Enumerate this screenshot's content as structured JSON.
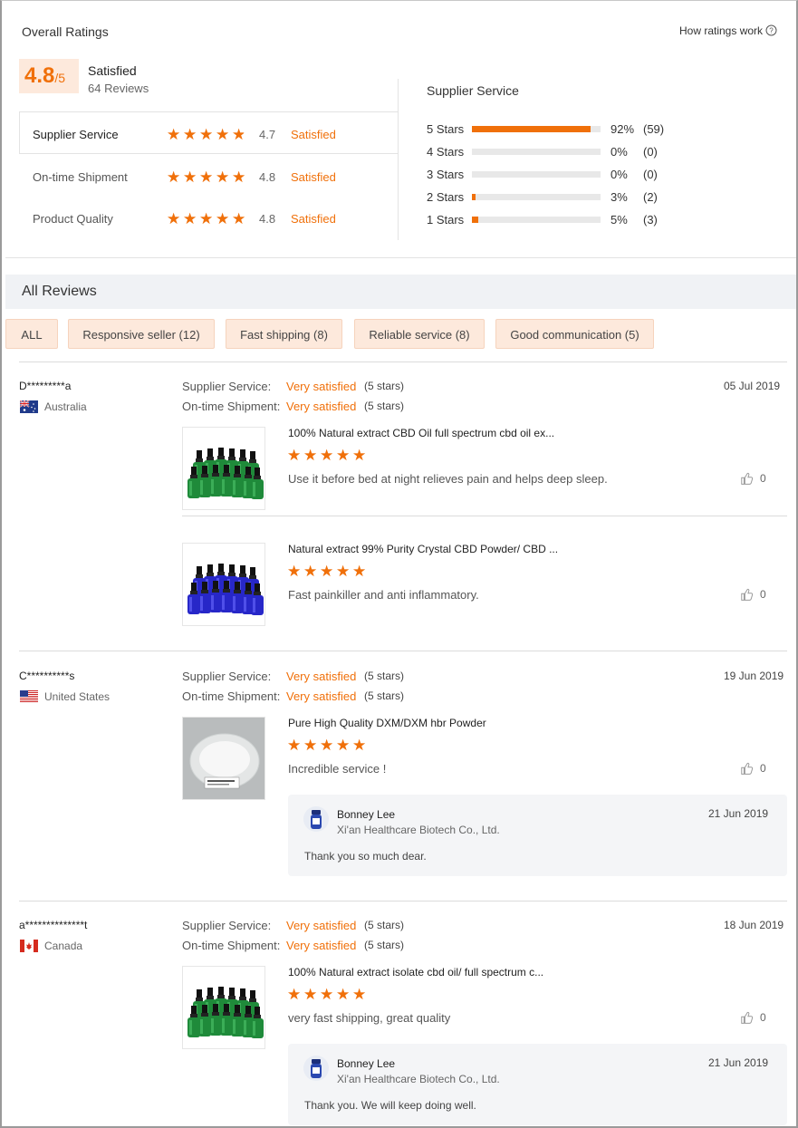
{
  "overall": {
    "title": "Overall Ratings",
    "how_link": "How ratings work",
    "score": "4.8",
    "score_suffix": "/5",
    "label": "Satisfied",
    "reviews_count": "64 Reviews",
    "metrics": [
      {
        "name": "Supplier Service",
        "rating": 4.7,
        "value": "4.7",
        "label": "Satisfied"
      },
      {
        "name": "On-time Shipment",
        "rating": 4.8,
        "value": "4.8",
        "label": "Satisfied"
      },
      {
        "name": "Product Quality",
        "rating": 4.8,
        "value": "4.8",
        "label": "Satisfied"
      }
    ]
  },
  "distribution": {
    "title": "Supplier Service",
    "rows": [
      {
        "label": "5 Stars",
        "fraction": 0.92,
        "percent": "92%",
        "count": "(59)"
      },
      {
        "label": "4 Stars",
        "fraction": 0,
        "percent": "0%",
        "count": "(0)"
      },
      {
        "label": "3 Stars",
        "fraction": 0,
        "percent": "0%",
        "count": "(0)"
      },
      {
        "label": "2 Stars",
        "fraction": 0.03,
        "percent": "3%",
        "count": "(2)"
      },
      {
        "label": "1 Stars",
        "fraction": 0.05,
        "percent": "5%",
        "count": "(3)"
      }
    ]
  },
  "reviews_header": "All Reviews",
  "filters": [
    "ALL",
    "Responsive seller (12)",
    "Fast shipping (8)",
    "Reliable service (8)",
    "Good communication (5)"
  ],
  "labels": {
    "supplier_service": "Supplier Service:",
    "ontime_shipment": "On-time Shipment:",
    "very_satisfied": "Very satisfied",
    "five_stars": "(5 stars)"
  },
  "reviews": [
    {
      "user": "D*********a",
      "country": "Australia",
      "flag": "australia",
      "date": "05 Jul 2019",
      "products": [
        {
          "title": "100% Natural extract CBD Oil full spectrum cbd oil ex...",
          "text": "Use it before bed at night relieves pain and helps deep sleep.",
          "likes": "0",
          "image": "green-bottles"
        },
        {
          "title": "Natural extract 99% Purity Crystal CBD Powder/ CBD ...",
          "text": "Fast painkiller and anti inflammatory.",
          "likes": "0",
          "image": "blue-bottles"
        }
      ]
    },
    {
      "user": "C**********s",
      "country": "United States",
      "flag": "usa",
      "date": "19 Jun 2019",
      "products": [
        {
          "title": "Pure High Quality DXM/DXM hbr Powder",
          "text": "Incredible service !",
          "likes": "0",
          "image": "white-powder"
        }
      ],
      "reply": {
        "name": "Bonney Lee",
        "company": "Xi'an Healthcare Biotech Co., Ltd.",
        "date": "21 Jun 2019",
        "text": "Thank you so much dear."
      }
    },
    {
      "user": "a**************t",
      "country": "Canada",
      "flag": "canada",
      "date": "18 Jun 2019",
      "products": [
        {
          "title": "100% Natural extract isolate cbd oil/ full spectrum c...",
          "text": "very fast shipping, great quality",
          "likes": "0",
          "image": "green-bottles"
        }
      ],
      "reply": {
        "name": "Bonney Lee",
        "company": "Xi'an Healthcare Biotech Co., Ltd.",
        "date": "21 Jun 2019",
        "text": "Thank you. We will keep doing well."
      }
    }
  ],
  "colors": {
    "accent": "#f0700a",
    "chip_bg": "#fde9dc",
    "header_bg": "#f0f2f5"
  }
}
